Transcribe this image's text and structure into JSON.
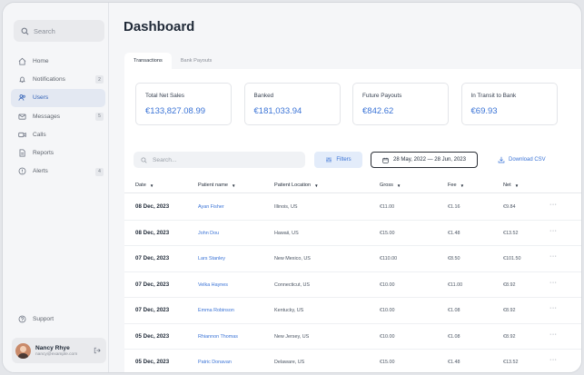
{
  "sidebar": {
    "search_placeholder": "Search",
    "items": [
      {
        "label": "Home",
        "icon": "home-icon",
        "badge": ""
      },
      {
        "label": "Notifications",
        "icon": "bell-icon",
        "badge": "2"
      },
      {
        "label": "Users",
        "icon": "users-icon",
        "badge": ""
      },
      {
        "label": "Messages",
        "icon": "mail-icon",
        "badge": "5"
      },
      {
        "label": "Calls",
        "icon": "video-icon",
        "badge": ""
      },
      {
        "label": "Reports",
        "icon": "document-icon",
        "badge": ""
      },
      {
        "label": "Alerts",
        "icon": "alert-icon",
        "badge": "4"
      }
    ],
    "support_label": "Support",
    "user": {
      "name": "Nancy Rhye",
      "email": "nancy@example.com"
    }
  },
  "header": {
    "title": "Dashboard"
  },
  "tabs": [
    {
      "label": "Transactions",
      "active": true
    },
    {
      "label": "Bank Payouts",
      "active": false
    }
  ],
  "summary_cards": [
    {
      "label": "Total Net Sales",
      "value": "€133,827.08.99"
    },
    {
      "label": "Banked",
      "value": "€181,033.94"
    },
    {
      "label": "Future Payouts",
      "value": "€842.62"
    },
    {
      "label": "In Transit to Bank",
      "value": "€69.93"
    }
  ],
  "toolbar": {
    "search_placeholder": "Search...",
    "filters_label": "Filters",
    "date_range": "28 May, 2022 — 28 Jun, 2023",
    "download_label": "Download CSV"
  },
  "table": {
    "columns": [
      "Date",
      "Patient name",
      "Patient Location",
      "Gross",
      "Fee",
      "Net"
    ],
    "rows": [
      {
        "date": "08 Dec, 2023",
        "name": "Ayan Fisher",
        "location": "Illinois, US",
        "gross": "€11.00",
        "fee": "€1.16",
        "net": "€9.84"
      },
      {
        "date": "08 Dec, 2023",
        "name": "John Dou",
        "location": "Hawaii, US",
        "gross": "€15.00",
        "fee": "€1.48",
        "net": "€13.52"
      },
      {
        "date": "07 Dec, 2023",
        "name": "Lars Stanley",
        "location": "New Mexico, US",
        "gross": "€110.00",
        "fee": "€8.50",
        "net": "€101.50"
      },
      {
        "date": "07 Dec, 2023",
        "name": "Velka Haynes",
        "location": "Connecticut, US",
        "gross": "€10.00",
        "fee": "€11.00",
        "net": "€8.92"
      },
      {
        "date": "07 Dec, 2023",
        "name": "Emma Robinson",
        "location": "Kentucky, US",
        "gross": "€10.00",
        "fee": "€1.08",
        "net": "€8.92"
      },
      {
        "date": "05 Dec, 2023",
        "name": "Rhiannon Thomas",
        "location": "New Jersey, US",
        "gross": "€10.00",
        "fee": "€1.08",
        "net": "€8.92"
      },
      {
        "date": "05 Dec, 2023",
        "name": "Patric Donavan",
        "location": "Delaware, US",
        "gross": "€15.00",
        "fee": "€1.48",
        "net": "€13.52"
      }
    ]
  },
  "colors": {
    "accent": "#3a73d6",
    "active_nav_bg": "#e3e8f2"
  }
}
